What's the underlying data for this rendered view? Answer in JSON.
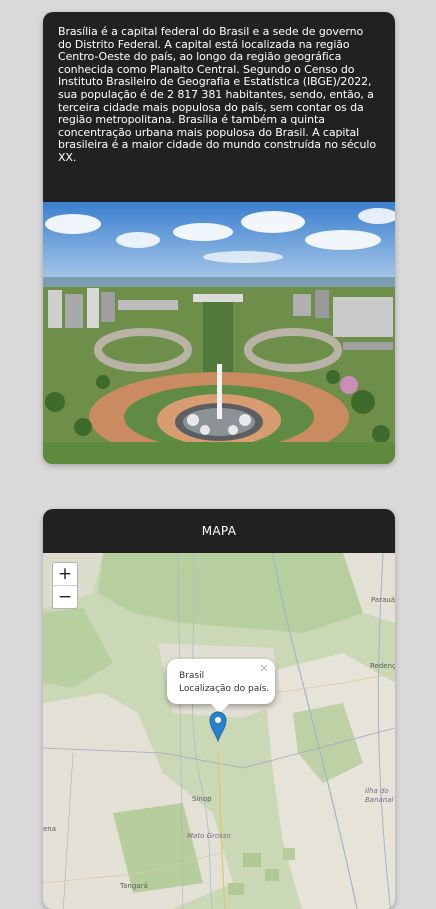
{
  "info_card": {
    "description": "Brasília é a capital federal do Brasil e a sede de governo do Distrito Federal. A capital está localizada na região Centro-Oeste do país, ao longo da região geográfica conhecida como Planalto Central. Segundo o Censo do Instituto Brasileiro de Geografia e Estatística (IBGE)/2022, sua população é de 2 817 381 habitantes, sendo, então, a terceira cidade mais populosa do país, sem contar os da região metropolitana. Brasília é também a quinta concentração urbana mais populosa do Brasil. A capital brasileira é a maior cidade do mundo construída no século XX."
  },
  "map_card": {
    "title": "MAPA",
    "zoom_in": "+",
    "zoom_out": "−",
    "popup": {
      "close": "×",
      "title": "Brasil",
      "subtitle": "Localização do país."
    },
    "labels": {
      "paraua": "Parauá",
      "redencao": "Redenç",
      "sinop": "Sinop",
      "ilha": "Ilha do",
      "bananal": "Bananal",
      "mato_grosso": "Mato Grosso",
      "ena": "ena",
      "tangara": "Tangará"
    }
  },
  "colors": {
    "card_bg": "#212121",
    "page_bg": "#d9d9d9",
    "marker": "#2a81cb",
    "map_green": "#c9d7b4"
  }
}
